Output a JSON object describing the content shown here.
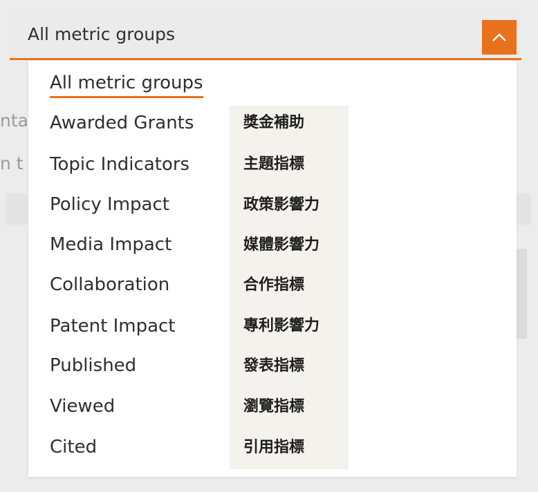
{
  "select": {
    "value": "All metric groups",
    "toggle_icon": "chevron-up-icon"
  },
  "background": {
    "fragment_1": "nta",
    "fragment_2": "n t"
  },
  "menu": {
    "options": [
      {
        "label": "All metric groups",
        "selected": true
      },
      {
        "label": "Awarded Grants",
        "translation": "獎金補助"
      },
      {
        "label": "Topic Indicators",
        "translation": "主題指標"
      },
      {
        "label": "Policy Impact",
        "translation": "政策影響力"
      },
      {
        "label": "Media Impact",
        "translation": "媒體影響力"
      },
      {
        "label": "Collaboration",
        "translation": "合作指標"
      },
      {
        "label": "Patent Impact",
        "translation": "專利影響力"
      },
      {
        "label": "Published",
        "translation": "發表指標"
      },
      {
        "label": "Viewed",
        "translation": "瀏覽指標"
      },
      {
        "label": "Cited",
        "translation": "引用指標"
      }
    ]
  },
  "colors": {
    "accent": "#e9711c",
    "text": "#2e2e2e",
    "annotation_bg": "#f3f2ec"
  }
}
